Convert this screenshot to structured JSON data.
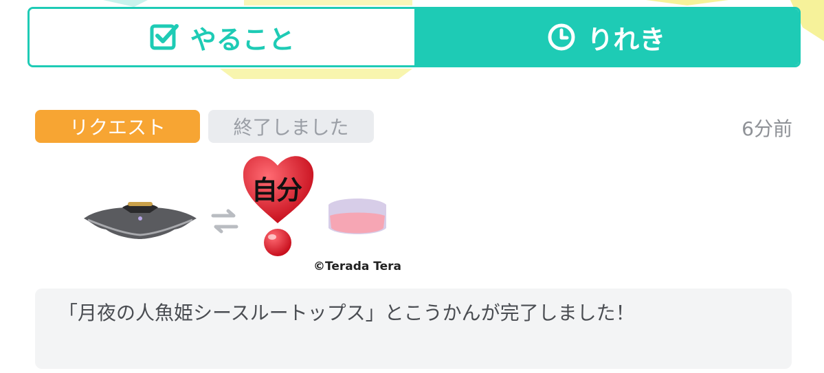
{
  "tabs": {
    "todo_label": "やること",
    "history_label": "りれき",
    "active": "りれき"
  },
  "entry": {
    "type_badge": "リクエスト",
    "status_badge": "終了しました",
    "timestamp": "6分前",
    "sticker_text": "自分",
    "copyright": "©Terada Tera",
    "message": "「月夜の人魚姫シースルートップス」とこうかんが完了しました！"
  },
  "icons": {
    "todo": "checkbox-icon",
    "history": "clock-icon",
    "swap": "swap-arrows-icon"
  },
  "colors": {
    "accent": "#1ecbb5",
    "request_badge": "#f7a533",
    "status_badge_bg": "#eaecef",
    "message_bg": "#f3f4f5"
  }
}
